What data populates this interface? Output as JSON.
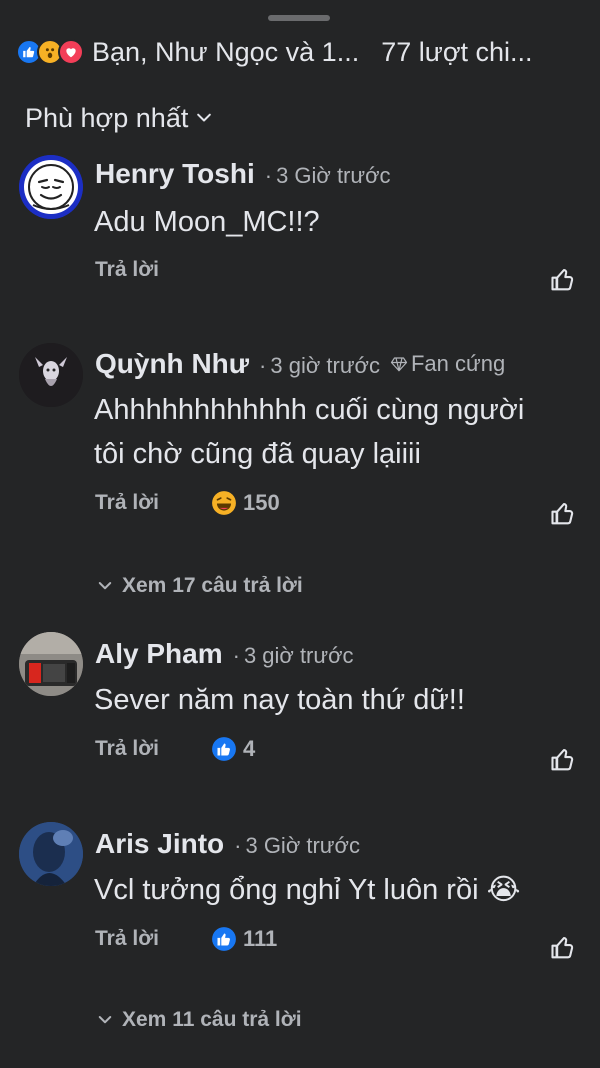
{
  "header": {
    "reactions": [
      "like-icon",
      "wow-icon",
      "love-icon"
    ],
    "reactors_text": "Bạn, Như Ngọc và 1...",
    "share_count_text": "77 lượt chi..."
  },
  "sort": {
    "label": "Phù hợp nhất"
  },
  "comments": [
    {
      "name": "Henry Toshi",
      "time": "3 Giờ trước",
      "badge": "",
      "text_lines": [
        "Adu Moon_MC!!?"
      ],
      "reply_label": "Trả lời",
      "reaction_icon": "",
      "reaction_count": "",
      "view_replies": ""
    },
    {
      "name": "Quỳnh Như",
      "time": "3 giờ trước",
      "badge": "Fan cứng",
      "text_lines": [
        "Ahhhhhhhhhhhh cuối cùng người",
        "tôi chờ cũng đã quay lạiiii"
      ],
      "reply_label": "Trả lời",
      "reaction_icon": "haha-icon",
      "reaction_count": "150",
      "view_replies": "Xem 17 câu trả lời"
    },
    {
      "name": "Aly Pham",
      "time": "3 giờ trước",
      "badge": "",
      "text_lines": [
        "Sever năm nay toàn thứ dữ!!"
      ],
      "reply_label": "Trả lời",
      "reaction_icon": "like-icon",
      "reaction_count": "4",
      "view_replies": ""
    },
    {
      "name": "Aris Jinto",
      "time": "3 Giờ trước",
      "badge": "",
      "text_lines": [
        "Vcl tưởng ổng nghỉ Yt luôn rồi 😭"
      ],
      "reply_label": "Trả lời",
      "reaction_icon": "like-icon",
      "reaction_count": "111",
      "view_replies": "Xem 11 câu trả lời"
    }
  ],
  "colors": {
    "background": "#242526",
    "primary_text": "#e4e6eb",
    "secondary_text": "#b0b3b8",
    "like_blue": "#1877f2",
    "love_red": "#f33e58",
    "wow_yellow": "#f7b125"
  }
}
